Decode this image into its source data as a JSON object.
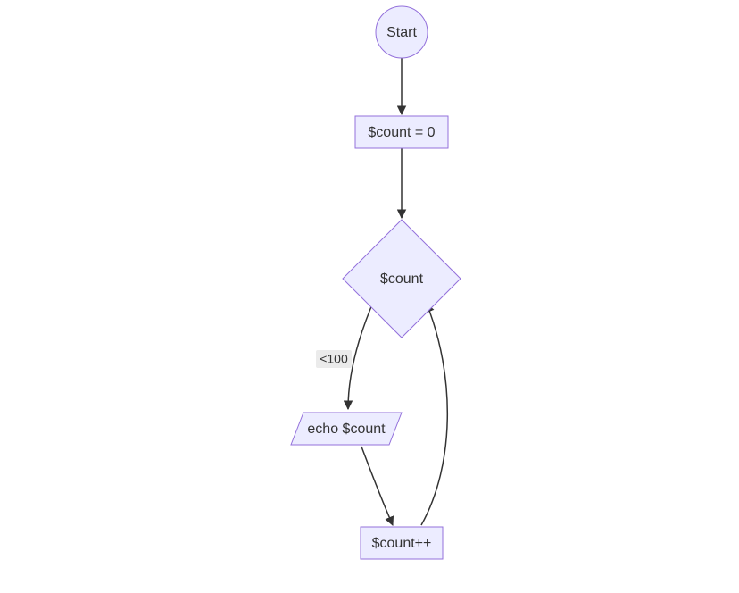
{
  "diagram": {
    "type": "flowchart",
    "nodes": {
      "start": {
        "shape": "circle",
        "label": "Start"
      },
      "init": {
        "shape": "rect",
        "label": "$count = 0"
      },
      "cond": {
        "shape": "diamond",
        "label": "$count"
      },
      "echo": {
        "shape": "parallelogram",
        "label": "echo $count"
      },
      "increment": {
        "shape": "rect",
        "label": "$count++"
      }
    },
    "edges": [
      {
        "from": "start",
        "to": "init",
        "label": ""
      },
      {
        "from": "init",
        "to": "cond",
        "label": ""
      },
      {
        "from": "cond",
        "to": "echo",
        "label": "<100"
      },
      {
        "from": "echo",
        "to": "increment",
        "label": ""
      },
      {
        "from": "increment",
        "to": "cond",
        "label": ""
      }
    ],
    "colors": {
      "node_fill": "#ECECFF",
      "node_stroke": "#9370DB",
      "edge": "#333333",
      "edge_label_bg": "#e8e8e8"
    }
  }
}
